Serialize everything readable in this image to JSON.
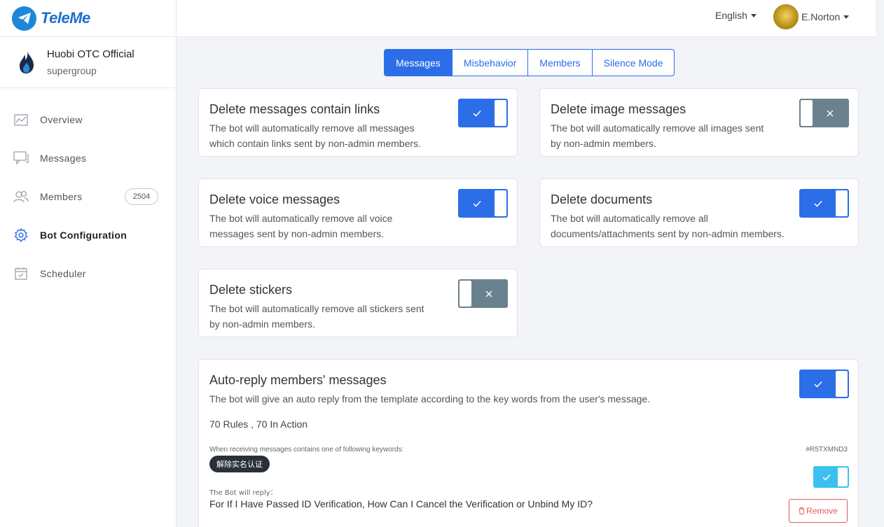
{
  "app": {
    "name": "TeleMe"
  },
  "group": {
    "name": "Huobi OTC Official",
    "type": "supergroup"
  },
  "nav": [
    {
      "label": "Overview",
      "icon": "chart-icon"
    },
    {
      "label": "Messages",
      "icon": "chat-icon"
    },
    {
      "label": "Members",
      "icon": "members-icon",
      "badge": "2504"
    },
    {
      "label": "Bot Configuration",
      "icon": "gear-icon",
      "active": true
    },
    {
      "label": "Scheduler",
      "icon": "calendar-icon"
    }
  ],
  "header": {
    "language": "English",
    "user": "E.Norton"
  },
  "tabs": [
    {
      "label": "Messages",
      "active": true
    },
    {
      "label": "Misbehavior"
    },
    {
      "label": "Members"
    },
    {
      "label": "Silence Mode"
    }
  ],
  "settings": [
    {
      "title": "Delete messages contain links",
      "desc1": "The bot will automatically remove all messages",
      "desc2": "which contain links sent by non-admin members.",
      "enabled": true
    },
    {
      "title": "Delete image messages",
      "desc1": "The bot will automatically remove all images sent",
      "desc2": "by non-admin members.",
      "enabled": false
    },
    {
      "title": "Delete voice messages",
      "desc1": "The bot will automatically remove all voice",
      "desc2": "messages sent by non-admin members.",
      "enabled": true
    },
    {
      "title": "Delete documents",
      "desc1": "The bot will automatically remove all",
      "desc2": "documents/attachments sent by non-admin members.",
      "enabled": true
    },
    {
      "title": "Delete stickers",
      "desc1": "The bot will automatically remove all stickers sent",
      "desc2": "by non-admin members.",
      "enabled": false
    }
  ],
  "autoreply": {
    "title": "Auto-reply members' messages",
    "desc": "The bot will give an auto reply from the template according to the key words from the user's message.",
    "enabled": true,
    "rules_summary": "70 Rules , 70 In Action",
    "keywords_label": "When receiving messages contains one of following keywords:",
    "rule_id": "#R5TXMND3",
    "keyword": "解除实名认证",
    "reply_label": "The Bot will reply：",
    "reply_text": "For If I Have Passed ID Verification, How Can I Cancel the Verification or Unbind My ID?",
    "rule_enabled": true,
    "remove_label": "Remove"
  },
  "colors": {
    "primary": "#2c6ee8",
    "toggle_off": "#6a828d",
    "toggle_rule": "#3cc1ee",
    "danger": "#e05a5a"
  }
}
